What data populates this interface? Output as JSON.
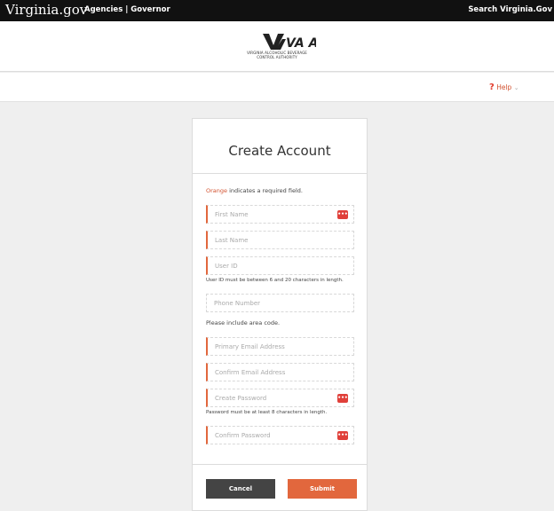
{
  "topbar": {
    "site": "Virginia.gov",
    "links": "Agencies | Governor",
    "search": "Search Virginia.Gov"
  },
  "brand": {
    "logo": "VA ABC",
    "org_line1": "VIRGINIA ALCOHOLIC BEVERAGE",
    "org_line2": "CONTROL AUTHORITY"
  },
  "help": {
    "icon": "question-icon",
    "label": "Help"
  },
  "form": {
    "title": "Create Account",
    "required_word": "Orange",
    "required_rest": " indicates a required field.",
    "fields": [
      {
        "placeholder": "First Name"
      },
      {
        "placeholder": "Last Name"
      },
      {
        "placeholder": "User ID"
      },
      {
        "placeholder": "Phone Number"
      },
      {
        "placeholder": "Primary Email Address"
      },
      {
        "placeholder": "Confirm Email Address"
      },
      {
        "placeholder": "Create Password"
      },
      {
        "placeholder": "Confirm Password"
      }
    ],
    "hints": {
      "user_id": "User ID must be between 6 and 20 characters in length.",
      "phone": "Please include area code.",
      "password": "Password must be at least 8 characters in length."
    },
    "cancel": "Cancel",
    "submit": "Submit"
  },
  "colors": {
    "accent": "#e2673d",
    "topbar": "#111111",
    "cancel": "#444444"
  }
}
